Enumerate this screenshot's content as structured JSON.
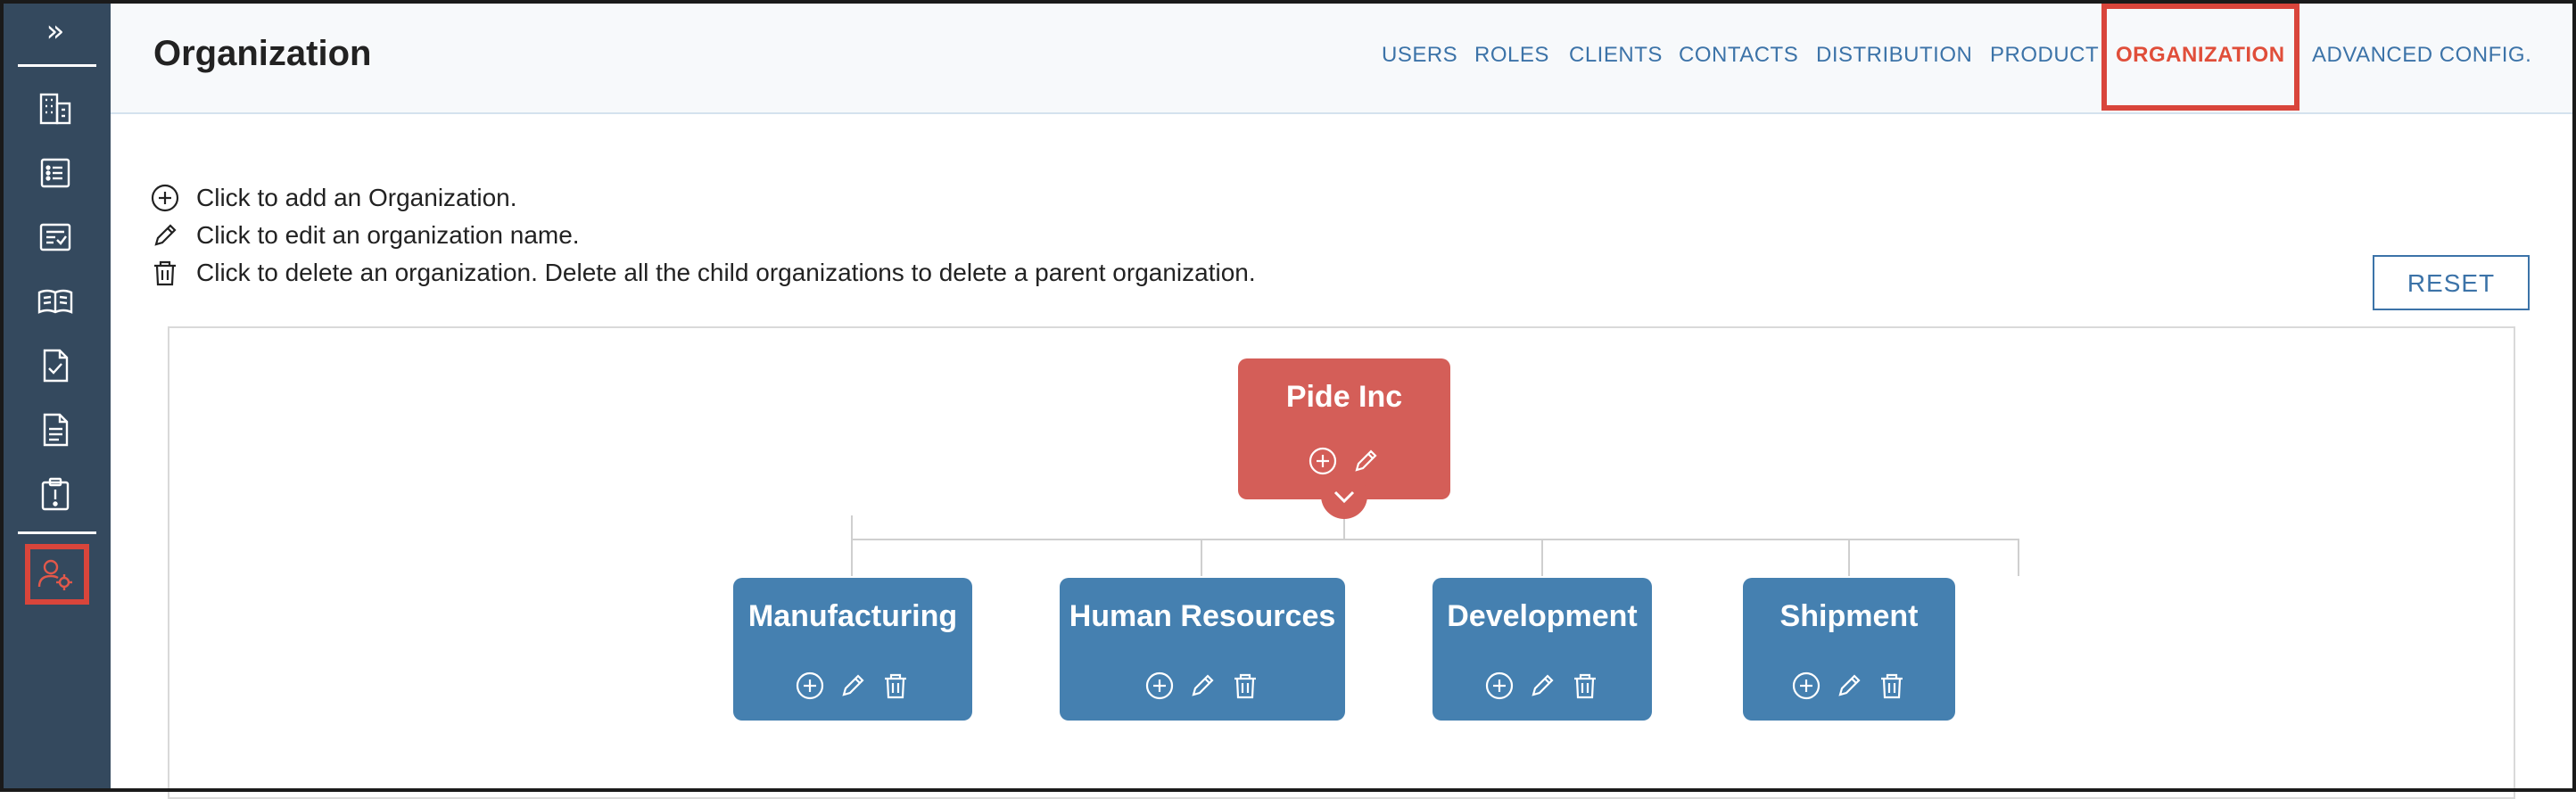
{
  "sidebar": {
    "expand_glyph": "»",
    "icons": [
      "buildings-icon",
      "list-icon",
      "checklist-icon",
      "book-icon",
      "document-check-icon",
      "document-icon",
      "clipboard-alert-icon",
      "user-settings-icon"
    ],
    "active_icon": "user-settings-icon"
  },
  "header": {
    "title": "Organization",
    "tabs": [
      {
        "label": "USERS"
      },
      {
        "label": "ROLES"
      },
      {
        "label": "CLIENTS"
      },
      {
        "label": "CONTACTS"
      },
      {
        "label": "DISTRIBUTION"
      },
      {
        "label": "PRODUCT"
      },
      {
        "label": "ORGANIZATION"
      },
      {
        "label": "ADVANCED CONFIG."
      }
    ],
    "active_tab": "ORGANIZATION"
  },
  "instructions": [
    {
      "icon": "plus-circle-icon",
      "text": "Click to add an Organization."
    },
    {
      "icon": "pencil-icon",
      "text": "Click to edit an organization name."
    },
    {
      "icon": "trash-icon",
      "text": "Click to delete an organization. Delete all the child organizations to delete a parent organization."
    }
  ],
  "reset_label": "RESET",
  "org_tree": {
    "root": {
      "name": "Pide Inc",
      "color": "#d45e58"
    },
    "children": [
      {
        "name": "Manufacturing"
      },
      {
        "name": "Human Resources"
      },
      {
        "name": "Development"
      },
      {
        "name": "Shipment"
      }
    ],
    "child_color": "#4580b0"
  },
  "colors": {
    "sidebar": "#34495e",
    "accent_active": "#e04e3a",
    "highlight": "#d9453b",
    "link": "#3c73a8"
  }
}
